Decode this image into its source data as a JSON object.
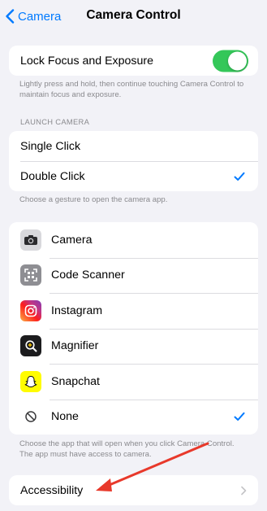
{
  "nav": {
    "back_label": "Camera",
    "title": "Camera Control"
  },
  "lock_focus": {
    "label": "Lock Focus and Exposure",
    "enabled": true,
    "note": "Lightly press and hold, then continue touching Camera Control to maintain focus and exposure."
  },
  "launch_camera": {
    "header": "LAUNCH CAMERA",
    "options": [
      "Single Click",
      "Double Click"
    ],
    "selected": "Double Click",
    "note": "Choose a gesture to open the camera app."
  },
  "apps": {
    "items": [
      {
        "label": "Camera",
        "icon": "camera-icon"
      },
      {
        "label": "Code Scanner",
        "icon": "code-scanner-icon"
      },
      {
        "label": "Instagram",
        "icon": "instagram-icon"
      },
      {
        "label": "Magnifier",
        "icon": "magnifier-icon"
      },
      {
        "label": "Snapchat",
        "icon": "snapchat-icon"
      },
      {
        "label": "None",
        "icon": "none-icon"
      }
    ],
    "selected": "None",
    "note": "Choose the app that will open when you click Camera Control. The app must have access to camera."
  },
  "accessibility": {
    "label": "Accessibility"
  },
  "colors": {
    "accent": "#007aff",
    "toggle_on": "#34c759",
    "background": "#f2f2f7",
    "annotation_arrow": "#e8392b"
  }
}
